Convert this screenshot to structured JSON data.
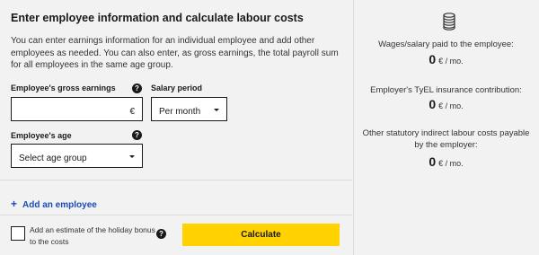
{
  "form": {
    "title": "Enter employee information and calculate labour costs",
    "intro": "You can enter earnings information for an individual employee and add other employees as needed. You can also enter, as gross earnings, the total payroll sum for all employees in the same age group.",
    "gross_earnings": {
      "label": "Employee's gross earnings",
      "value": "",
      "currency": "€"
    },
    "salary_period": {
      "label": "Salary period",
      "selected": "Per month"
    },
    "age": {
      "label": "Employee's age",
      "selected": "Select age group"
    },
    "help_glyph": "?",
    "add_employee": {
      "plus": "+",
      "label": "Add an employee"
    },
    "holiday_bonus": {
      "label": "Add an estimate of the holiday bonus to the costs",
      "checked": false
    },
    "calculate_label": "Calculate"
  },
  "results": {
    "icon": "coins-stack-icon",
    "items": [
      {
        "label": "Wages/salary paid to the employee:",
        "value": "0",
        "unit": "€ / mo."
      },
      {
        "label": "Employer's TyEL insurance contribution:",
        "value": "0",
        "unit": "€ / mo."
      },
      {
        "label": "Other statutory indirect labour costs payable by the employer:",
        "value": "0",
        "unit": "€ / mo."
      }
    ]
  },
  "colors": {
    "accent_yellow": "#ffd200",
    "link_blue": "#1a4bb8",
    "background": "#f2f2f2"
  }
}
